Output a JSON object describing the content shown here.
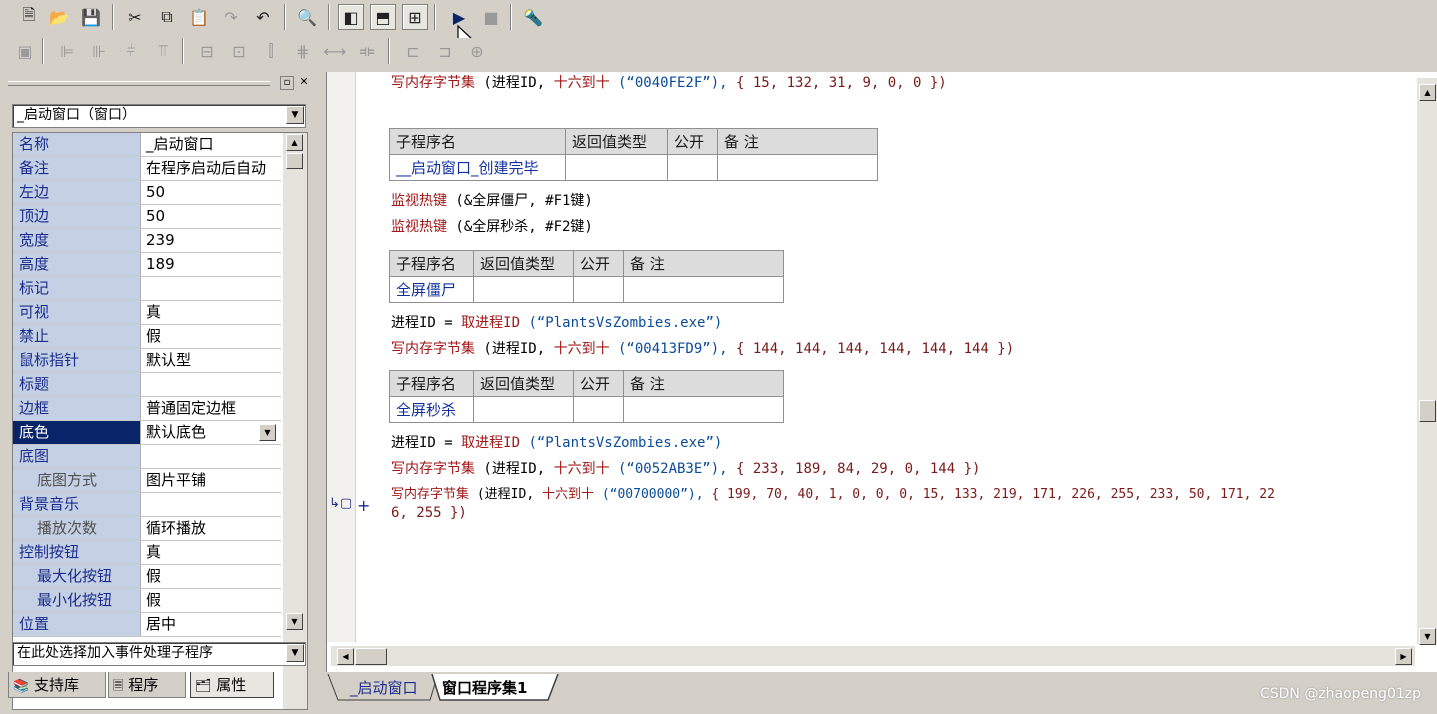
{
  "toolbar": {
    "row1": [
      "new-file-icon",
      "open-folder-icon",
      "save-icon",
      "cut-icon",
      "copy-icon",
      "paste-icon",
      "redo-icon",
      "undo-icon",
      "find-icon",
      "layout-left-icon",
      "layout-top-icon",
      "layout-grid-icon",
      "run-icon",
      "stop-icon",
      "debug-icon"
    ],
    "row2": [
      "align-icon",
      "align-left-icon",
      "align-center-icon",
      "align-right-icon",
      "align-top-icon",
      "align-middle-icon",
      "align-bottom-icon",
      "space-h-icon",
      "space-v-icon",
      "size-w-icon",
      "size-h-icon",
      "size-both-icon"
    ]
  },
  "left_panel": {
    "object_selector": "_启动窗口（窗口）",
    "properties": [
      {
        "name": "名称",
        "value": "_启动窗口"
      },
      {
        "name": "备注",
        "value": "在程序启动后自动"
      },
      {
        "name": "左边",
        "value": "50"
      },
      {
        "name": "顶边",
        "value": "50"
      },
      {
        "name": "宽度",
        "value": "239"
      },
      {
        "name": "高度",
        "value": "189"
      },
      {
        "name": "标记",
        "value": ""
      },
      {
        "name": "可视",
        "value": "真"
      },
      {
        "name": "禁止",
        "value": "假"
      },
      {
        "name": "鼠标指针",
        "value": "默认型"
      },
      {
        "name": "标题",
        "value": ""
      },
      {
        "name": "边框",
        "value": "普通固定边框"
      },
      {
        "name": "底色",
        "value": "默认底色"
      },
      {
        "name": "底图",
        "value": ""
      },
      {
        "name": "底图方式",
        "value": "图片平铺"
      },
      {
        "name": "背景音乐",
        "value": ""
      },
      {
        "name": "播放次数",
        "value": "循环播放"
      },
      {
        "name": "控制按钮",
        "value": "真"
      },
      {
        "name": "最大化按钮",
        "value": "假"
      },
      {
        "name": "最小化按钮",
        "value": "假"
      },
      {
        "name": "位置",
        "value": "居中"
      }
    ],
    "event_selector": "在此处选择加入事件处理子程序",
    "tabs": [
      "支持库",
      "程序",
      "属性"
    ]
  },
  "editor": {
    "line1": {
      "fn": "写内存字节集",
      "args": " (进程ID, ",
      "hex": "十六到十",
      "str": " (“0040FE2F”), ",
      "arr": "{ 15, 132, 31, 9, 0, 0 })"
    },
    "table_headers": {
      "name": "子程序名",
      "ret": "返回值类型",
      "pub": "公开",
      "note": "备 注"
    },
    "sub1": "__启动窗口_创建完毕",
    "hotkey1": {
      "fn": "监视热键",
      "args": " (&全屏僵尸, #F1键)"
    },
    "hotkey2": {
      "fn": "监视热键",
      "args": " (&全屏秒杀, #F2键)"
    },
    "sub2": "全屏僵尸",
    "getpid1": {
      "lhs": "进程ID = ",
      "fn": "取进程ID",
      "args": " (“PlantsVsZombies.exe”)"
    },
    "line2": {
      "fn": "写内存字节集",
      "args": " (进程ID, ",
      "hex": "十六到十",
      "str": " (“00413FD9”), ",
      "arr": "{ 144, 144, 144, 144, 144, 144 })"
    },
    "sub3": "全屏秒杀",
    "getpid2": {
      "lhs": "进程ID = ",
      "fn": "取进程ID",
      "args": " (“PlantsVsZombies.exe”)"
    },
    "line3": {
      "fn": "写内存字节集",
      "args": " (进程ID, ",
      "hex": "十六到十",
      "str": " (“0052AB3E”), ",
      "arr": "{ 233, 189, 84, 29, 0, 144 })"
    },
    "line4": {
      "fn": "写内存字节集",
      "args": " (进程ID, ",
      "hex": "十六到十",
      "str": " (“00700000”), ",
      "arr": "{ 199, 70, 40, 1, 0, 0, 0, 15, 133, 219, 171, 226, 255, 233, 50, 171, 22"
    },
    "line4_cont": "6, 255 })",
    "tabs": [
      "_启动窗口",
      "窗口程序集1"
    ]
  },
  "watermark": "CSDN @zhaopeng01zp"
}
